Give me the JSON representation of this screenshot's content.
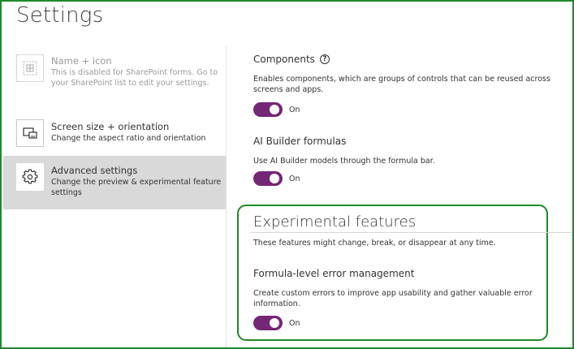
{
  "page": {
    "title": "Settings"
  },
  "nav": {
    "items": [
      {
        "title": "Name + icon",
        "description": "This is disabled for SharePoint forms. Go to your SharePoint list to edit your settings.",
        "icon": "app-grid-icon",
        "state": "disabled"
      },
      {
        "title": "Screen size + orientation",
        "description": "Change the aspect ratio and orientation",
        "icon": "screen-size-icon",
        "state": "normal"
      },
      {
        "title": "Advanced settings",
        "description": "Change the preview & experimental feature settings",
        "icon": "gear-icon",
        "state": "selected"
      }
    ]
  },
  "main": {
    "components": {
      "title": "Components",
      "help_icon": "help-icon",
      "help_glyph": "?",
      "description": "Enables components, which are groups of controls that can be reused across screens and apps.",
      "toggle_label": "On"
    },
    "ai_builder": {
      "title": "AI Builder formulas",
      "description": "Use AI Builder models through the formula bar.",
      "toggle_label": "On"
    },
    "experimental": {
      "title": "Experimental features",
      "description": "These features might change, break, or disappear at any time.",
      "feature": {
        "title": "Formula-level error management",
        "description": "Create custom errors to improve app usability and gather valuable error information.",
        "toggle_label": "On"
      }
    }
  },
  "colors": {
    "toggle_on": "#742774",
    "selected_nav_bg": "#d9d9d9",
    "highlight_border": "#1f8a2a"
  }
}
